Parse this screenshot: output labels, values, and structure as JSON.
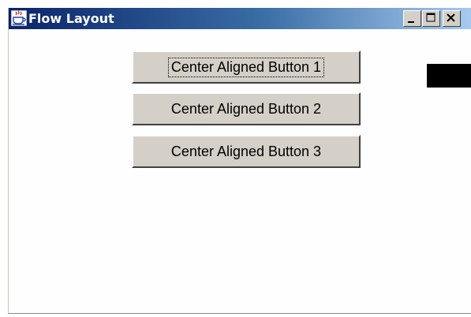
{
  "window": {
    "title": "Flow Layout",
    "title_controls": [
      {
        "name": "minimize",
        "icon": "minimize-icon"
      },
      {
        "name": "maximize",
        "icon": "maximize-icon"
      },
      {
        "name": "close",
        "icon": "close-icon"
      }
    ],
    "app_icon": "java-coffee-cup-icon"
  },
  "buttons": [
    {
      "label": "Center Aligned Button 1",
      "focused": true
    },
    {
      "label": "Center Aligned Button 2",
      "focused": false
    },
    {
      "label": "Center Aligned Button 3",
      "focused": false
    }
  ],
  "colors": {
    "titlebar_start": "#0a246a",
    "titlebar_end": "#a6caf0",
    "button_face": "#d4d0c8"
  }
}
